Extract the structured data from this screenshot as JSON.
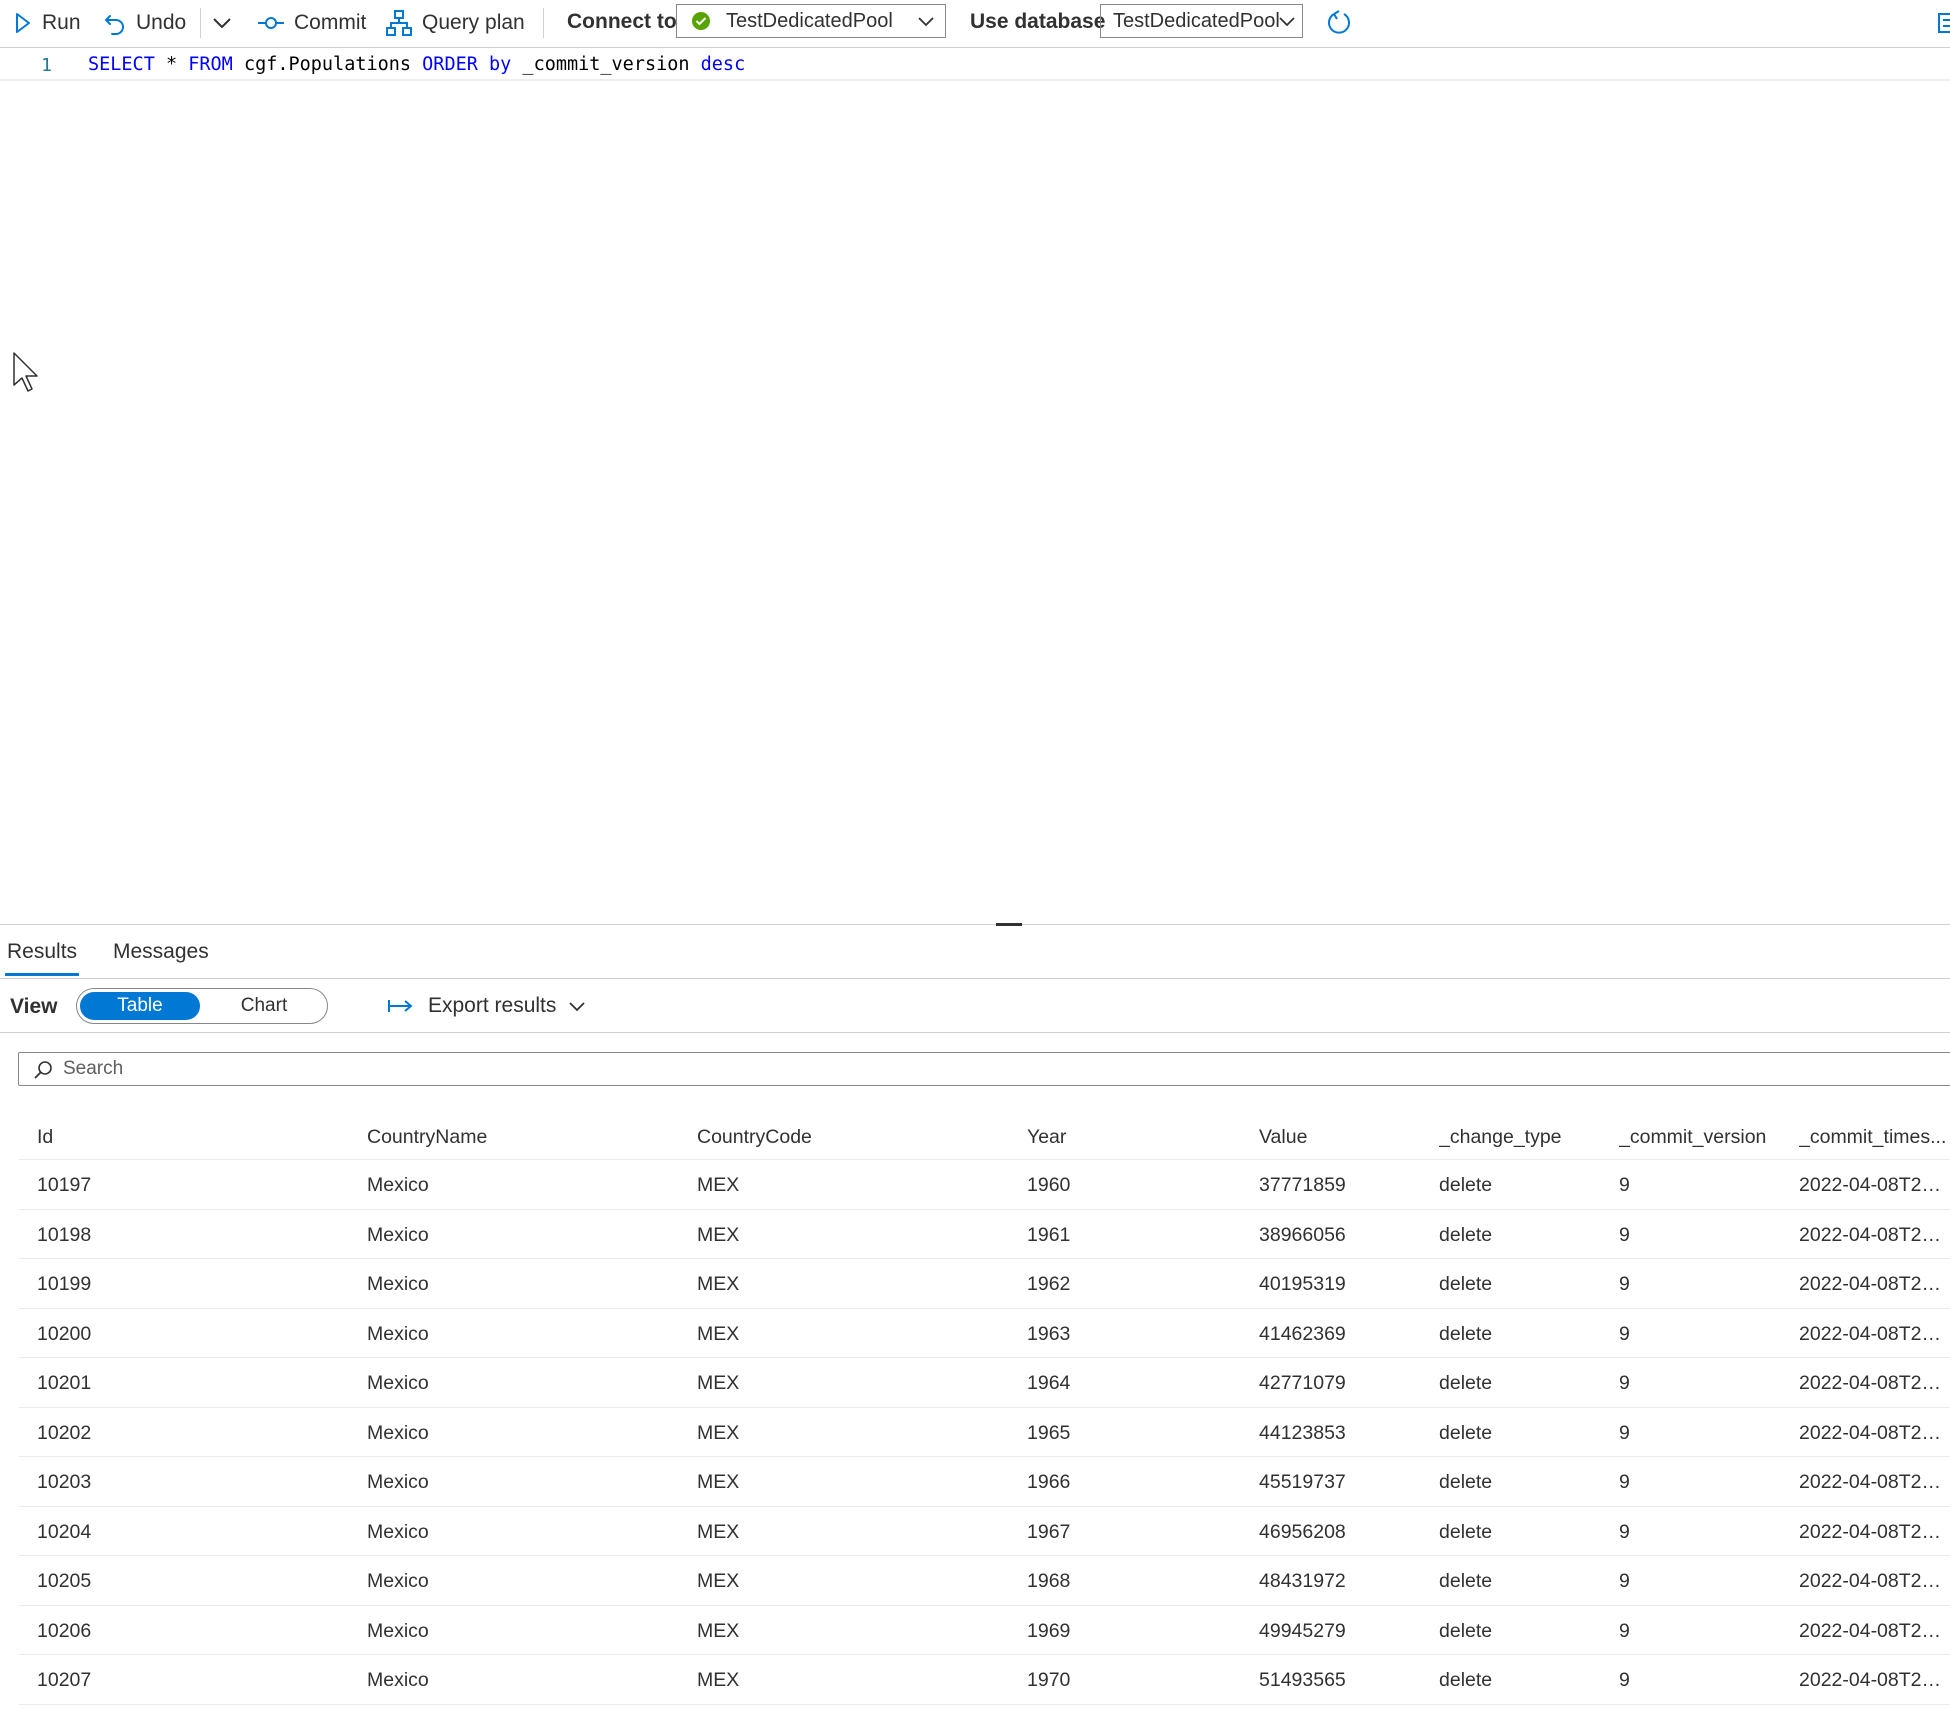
{
  "toolbar": {
    "run": "Run",
    "undo": "Undo",
    "commit": "Commit",
    "query_plan": "Query plan",
    "connect_to_label": "Connect to",
    "connect_to_value": "TestDedicatedPool",
    "use_database_label": "Use database",
    "use_database_value": "TestDedicatedPool",
    "connection_status_color": "#57a300",
    "accent_color": "#0078d4"
  },
  "editor": {
    "line_number": "1",
    "tokens": {
      "select": "SELECT",
      "star": " * ",
      "from": "FROM",
      "table": " cgf.Populations ",
      "order": "ORDER",
      "sp1": " ",
      "by": "by",
      "column": " _commit_version ",
      "desc": "desc"
    }
  },
  "results": {
    "tabs": [
      "Results",
      "Messages"
    ],
    "view_label": "View",
    "view_options": [
      "Table",
      "Chart"
    ],
    "view_selected": "Table",
    "export": "Export results",
    "search_placeholder": "Search",
    "columns": [
      "Id",
      "CountryName",
      "CountryCode",
      "Year",
      "Value",
      "_change_type",
      "_commit_version",
      "_commit_times..."
    ],
    "rows": [
      [
        "10197",
        "Mexico",
        "MEX",
        "1960",
        "37771859",
        "delete",
        "9",
        "2022-04-08T20:..."
      ],
      [
        "10198",
        "Mexico",
        "MEX",
        "1961",
        "38966056",
        "delete",
        "9",
        "2022-04-08T20:..."
      ],
      [
        "10199",
        "Mexico",
        "MEX",
        "1962",
        "40195319",
        "delete",
        "9",
        "2022-04-08T20:..."
      ],
      [
        "10200",
        "Mexico",
        "MEX",
        "1963",
        "41462369",
        "delete",
        "9",
        "2022-04-08T20:..."
      ],
      [
        "10201",
        "Mexico",
        "MEX",
        "1964",
        "42771079",
        "delete",
        "9",
        "2022-04-08T20:..."
      ],
      [
        "10202",
        "Mexico",
        "MEX",
        "1965",
        "44123853",
        "delete",
        "9",
        "2022-04-08T20:..."
      ],
      [
        "10203",
        "Mexico",
        "MEX",
        "1966",
        "45519737",
        "delete",
        "9",
        "2022-04-08T20:..."
      ],
      [
        "10204",
        "Mexico",
        "MEX",
        "1967",
        "46956208",
        "delete",
        "9",
        "2022-04-08T20:..."
      ],
      [
        "10205",
        "Mexico",
        "MEX",
        "1968",
        "48431972",
        "delete",
        "9",
        "2022-04-08T20:..."
      ],
      [
        "10206",
        "Mexico",
        "MEX",
        "1969",
        "49945279",
        "delete",
        "9",
        "2022-04-08T20:..."
      ],
      [
        "10207",
        "Mexico",
        "MEX",
        "1970",
        "51493565",
        "delete",
        "9",
        "2022-04-08T20:..."
      ]
    ]
  }
}
